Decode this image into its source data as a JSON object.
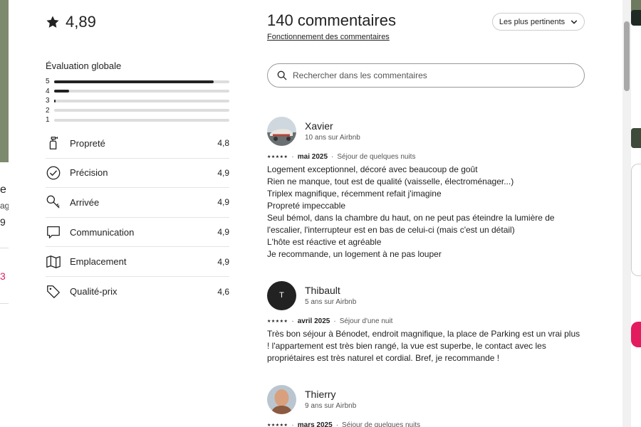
{
  "background": {
    "left_title_fragment": "e",
    "left_sub_fragment": "ag",
    "left_num_fragment": "9",
    "left_red_fragment": "3"
  },
  "overall": {
    "rating": "4,89",
    "icon": "star-icon"
  },
  "distribution": {
    "title": "Évaluation globale",
    "rows": [
      {
        "label": "5",
        "fraction": 0.91
      },
      {
        "label": "4",
        "fraction": 0.085
      },
      {
        "label": "3",
        "fraction": 0.01
      },
      {
        "label": "2",
        "fraction": 0
      },
      {
        "label": "1",
        "fraction": 0
      }
    ]
  },
  "categories": [
    {
      "name": "Propreté",
      "score": "4,8",
      "icon": "spray-bottle-icon"
    },
    {
      "name": "Précision",
      "score": "4,9",
      "icon": "check-circle-icon"
    },
    {
      "name": "Arrivée",
      "score": "4,9",
      "icon": "key-icon"
    },
    {
      "name": "Communication",
      "score": "4,9",
      "icon": "chat-bubble-icon"
    },
    {
      "name": "Emplacement",
      "score": "4,9",
      "icon": "map-icon"
    },
    {
      "name": "Qualité-prix",
      "score": "4,6",
      "icon": "tag-icon"
    }
  ],
  "header": {
    "count": "140 commentaires",
    "how_it_works": "Fonctionnement des commentaires",
    "sort_label": "Les plus pertinents"
  },
  "search": {
    "placeholder": "Rechercher dans les commentaires"
  },
  "reviews": [
    {
      "name": "Xavier",
      "tenure": "10 ans sur Airbnb",
      "avatar": "photo",
      "stars": "★★★★★",
      "date": "mai 2025",
      "stay": "Séjour de quelques nuits",
      "lines": [
        "Logement exceptionnel, décoré avec beaucoup de goût",
        "Rien ne manque, tout est de qualité (vaisselle, électroménager...)",
        "Triplex magnifique, récemment refait j'imagine",
        "Propreté impeccable",
        "Seul bémol, dans la chambre du haut, on ne peut pas éteindre la lumière de",
        "l'escalier, l'interrupteur est en bas de celui-ci (mais c'est un détail)",
        "L'hôte est réactive et agréable",
        "Je recommande, un logement à ne pas louper"
      ]
    },
    {
      "name": "Thibault",
      "tenure": "5 ans sur Airbnb",
      "avatar": "T",
      "stars": "★★★★★",
      "date": "avril 2025",
      "stay": "Séjour d'une nuit",
      "lines": [
        "Très bon séjour à Bénodet, endroit magnifique, la place de Parking est un vrai plus",
        "! l'appartement est très bien rangé, la vue est superbe, le contact avec les",
        "propriétaires est très naturel et cordial. Bref, je recommande !"
      ]
    },
    {
      "name": "Thierry",
      "tenure": "9 ans sur Airbnb",
      "avatar": "photo",
      "stars": "★★★★★",
      "date": "mars 2025",
      "stay": "Séjour de quelques nuits",
      "lines": []
    }
  ],
  "colors": {
    "text": "#222222",
    "muted": "#555555",
    "border": "#dddddd",
    "brand": "#e31c5f"
  }
}
